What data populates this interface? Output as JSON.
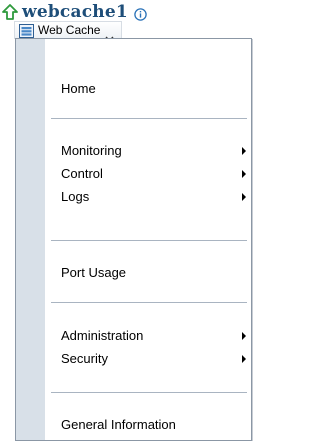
{
  "header": {
    "title": "webcache1",
    "menu_button_label": "Web Cache"
  },
  "menu": {
    "items": [
      {
        "label": "Home",
        "has_submenu": false
      },
      {
        "label": "Monitoring",
        "has_submenu": true
      },
      {
        "label": "Control",
        "has_submenu": true
      },
      {
        "label": "Logs",
        "has_submenu": true
      },
      {
        "label": "Port Usage",
        "has_submenu": false
      },
      {
        "label": "Administration",
        "has_submenu": true
      },
      {
        "label": "Security",
        "has_submenu": true
      },
      {
        "label": "General Information",
        "has_submenu": false
      }
    ]
  },
  "icons": {
    "title_icon": "up-arrow-icon",
    "info_icon": "info-icon",
    "menu_icon": "web-cache-icon",
    "dropdown_icon": "chevron-down-icon",
    "submenu_icon": "submenu-arrow-icon"
  },
  "colors": {
    "title": "#1e4e79",
    "up_arrow": "#2e9a3c",
    "menu_gutter": "#d8e0e8",
    "separator": "#a9b4c1"
  }
}
